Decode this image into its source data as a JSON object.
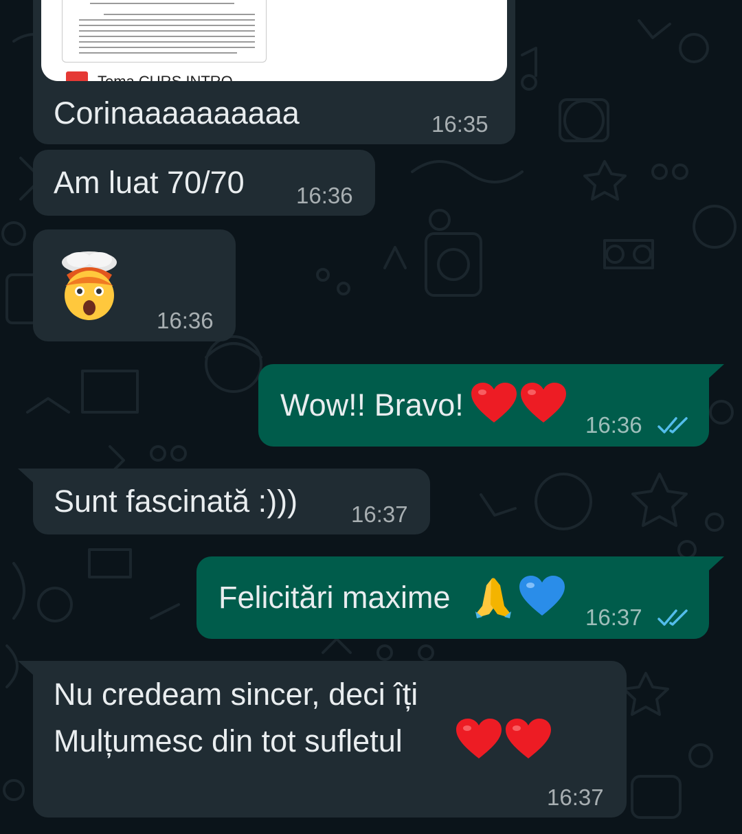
{
  "chat": {
    "messages": [
      {
        "id": "m1",
        "direction": "incoming",
        "attachment": {
          "type": "pdf-document",
          "file_name": "Tema CURS INTRO"
        },
        "text": "Corinaaaaaaaaaa",
        "time": "16:35"
      },
      {
        "id": "m2",
        "direction": "incoming",
        "text": "Am luat 70/70",
        "time": "16:36"
      },
      {
        "id": "m3",
        "direction": "incoming",
        "emoji": "🤯",
        "emoji_name": "exploding-head-emoji",
        "time": "16:36"
      },
      {
        "id": "m4",
        "direction": "outgoing",
        "text": "Wow!! Bravo!",
        "trailing_emoji": "❤️❤️",
        "time": "16:36",
        "status": "read"
      },
      {
        "id": "m5",
        "direction": "incoming",
        "text": "Sunt fascinată :)))",
        "time": "16:37"
      },
      {
        "id": "m6",
        "direction": "outgoing",
        "text": "Felicitări maxime",
        "trailing_emoji": "🙏💙",
        "time": "16:37",
        "status": "read"
      },
      {
        "id": "m7",
        "direction": "incoming",
        "lines": [
          "Nu credeam sincer, deci îți",
          "Mulțumesc din tot sufletul"
        ],
        "trailing_emoji": "❤️❤️",
        "time": "16:37"
      }
    ]
  },
  "colors": {
    "background": "#0b141a",
    "incoming_bubble": "#202c33",
    "outgoing_bubble": "#005c4b",
    "read_ticks": "#53bdeb",
    "text": "#e9edef"
  },
  "icons": {
    "read_receipt": "double-check-icon",
    "heart": "red-heart-emoji",
    "blue_heart": "blue-heart-emoji",
    "pray": "folded-hands-emoji",
    "pdf": "pdf-file-icon"
  }
}
